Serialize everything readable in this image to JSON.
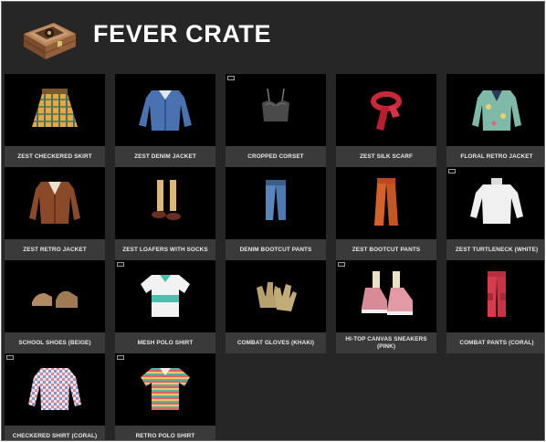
{
  "header": {
    "title": "FEVER CRATE",
    "icon": "crate-icon"
  },
  "items": [
    {
      "label": "ZEST CHECKERED SKIRT",
      "icon": "skirt-icon",
      "badge": false
    },
    {
      "label": "ZEST DENIM JACKET",
      "icon": "denim-jacket-icon",
      "badge": false
    },
    {
      "label": "CROPPED CORSET",
      "icon": "corset-icon",
      "badge": true
    },
    {
      "label": "ZEST SILK SCARF",
      "icon": "scarf-icon",
      "badge": false
    },
    {
      "label": "FLORAL RETRO JACKET",
      "icon": "floral-jacket-icon",
      "badge": false
    },
    {
      "label": "ZEST RETRO JACKET",
      "icon": "retro-jacket-icon",
      "badge": false
    },
    {
      "label": "ZEST LOAFERS WITH SOCKS",
      "icon": "loafers-icon",
      "badge": false
    },
    {
      "label": "DENIM BOOTCUT PANTS",
      "icon": "denim-pants-icon",
      "badge": false
    },
    {
      "label": "ZEST BOOTCUT PANTS",
      "icon": "bootcut-pants-icon",
      "badge": false
    },
    {
      "label": "ZEST TURTLENECK (WHITE)",
      "icon": "turtleneck-icon",
      "badge": true
    },
    {
      "label": "SCHOOL SHOES (BEIGE)",
      "icon": "shoes-icon",
      "badge": false
    },
    {
      "label": "MESH POLO SHIRT",
      "icon": "polo-shirt-icon",
      "badge": true
    },
    {
      "label": "COMBAT GLOVES (KHAKI)",
      "icon": "gloves-icon",
      "badge": false
    },
    {
      "label": "HI-TOP CANVAS SNEAKERS (PINK)",
      "icon": "sneakers-icon",
      "badge": true
    },
    {
      "label": "COMBAT PANTS (CORAL)",
      "icon": "combat-pants-icon",
      "badge": false
    },
    {
      "label": "CHECKERED SHIRT (CORAL)",
      "icon": "checkered-shirt-icon",
      "badge": true
    },
    {
      "label": "RETRO POLO SHIRT",
      "icon": "retro-polo-icon",
      "badge": true
    }
  ]
}
